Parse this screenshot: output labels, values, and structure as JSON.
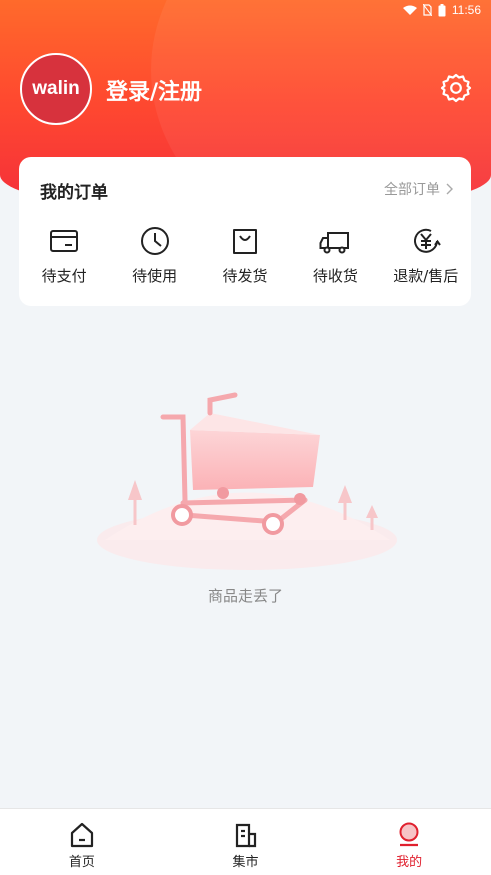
{
  "status_bar": {
    "time": "11:56"
  },
  "profile": {
    "avatar_text": "walin",
    "login_label": "登录/注册"
  },
  "orders": {
    "title": "我的订单",
    "all_label": "全部订单",
    "items": [
      {
        "label": "待支付",
        "icon": "card-icon"
      },
      {
        "label": "待使用",
        "icon": "clock-icon"
      },
      {
        "label": "待发货",
        "icon": "bag-icon"
      },
      {
        "label": "待收货",
        "icon": "truck-icon"
      },
      {
        "label": "退款/售后",
        "icon": "refund-icon"
      }
    ]
  },
  "empty": {
    "text": "商品走丢了"
  },
  "tabbar": {
    "tabs": [
      {
        "label": "首页",
        "icon": "home-icon"
      },
      {
        "label": "集市",
        "icon": "market-icon"
      },
      {
        "label": "我的",
        "icon": "profile-icon",
        "active": true
      }
    ]
  },
  "colors": {
    "accent": "#e0202e",
    "hero_top": "#ff6a2b",
    "hero_bottom": "#f42d3b"
  }
}
